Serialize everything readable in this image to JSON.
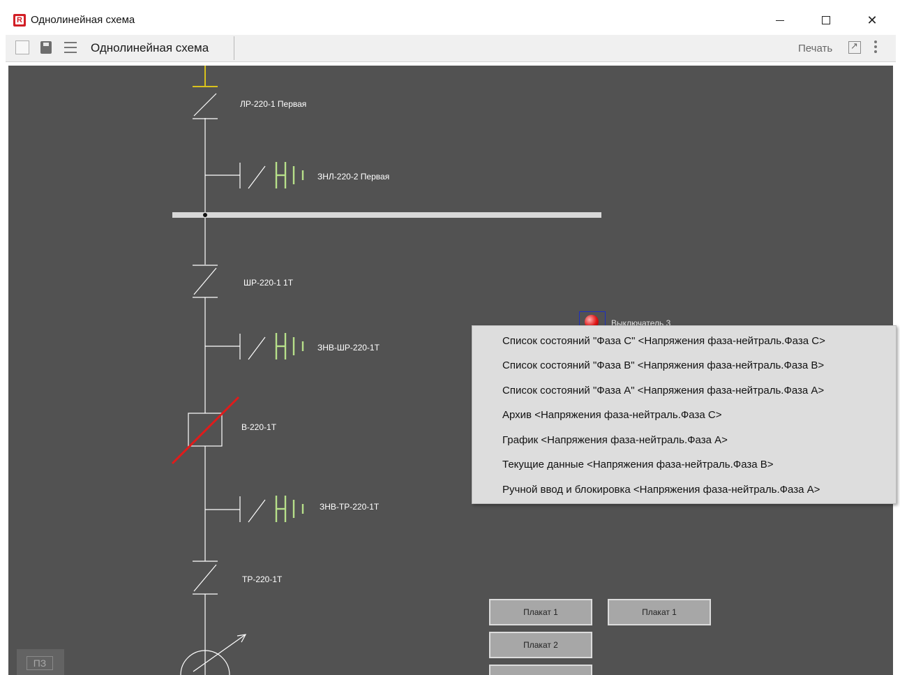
{
  "window": {
    "title": "Однолинейная схема",
    "minimize_glyph": "—",
    "maximize_glyph": "☐",
    "close_glyph": "✕"
  },
  "toolbar": {
    "title": "Однолинейная схема",
    "print_label": "Печать",
    "icons": [
      "checkbox-icon",
      "save-icon",
      "menu-icon",
      "expand-icon",
      "more-icon"
    ]
  },
  "scheme": {
    "elements": [
      {
        "label": "ЛР-220-1 Первая"
      },
      {
        "label": "ЗНЛ-220-2 Первая"
      },
      {
        "label": "ШР-220-1 1Т"
      },
      {
        "label": "ЗНВ-ШР-220-1Т"
      },
      {
        "label": "В-220-1Т"
      },
      {
        "label": "ЗНВ-ТР-220-1Т"
      },
      {
        "label": "ТР-220-1Т"
      }
    ],
    "indicator_label": "Выключатель 3",
    "pz_button": "ПЗ",
    "posters": [
      "Плакат 1",
      "Плакат 1",
      "Плакат 2"
    ],
    "colors": {
      "background": "#525252",
      "line": "#ffffff",
      "grounding_switch": "#b7e08a",
      "busbar_top": "#d9c21c",
      "breaker_strike": "#e01b1b",
      "bus": "#d8d8d8"
    }
  },
  "context_menu": {
    "items": [
      "Список состояний \"Фаза C\" <Напряжения фаза-нейтраль.Фаза C>",
      "Список состояний \"Фаза B\" <Напряжения фаза-нейтраль.Фаза B>",
      "Список состояний \"Фаза A\" <Напряжения фаза-нейтраль.Фаза A>",
      "Архив <Напряжения фаза-нейтраль.Фаза C>",
      "График <Напряжения фаза-нейтраль.Фаза A>",
      "Текущие данные <Напряжения фаза-нейтраль.Фаза B>",
      "Ручной ввод и блокировка <Напряжения фаза-нейтраль.Фаза A>"
    ]
  }
}
